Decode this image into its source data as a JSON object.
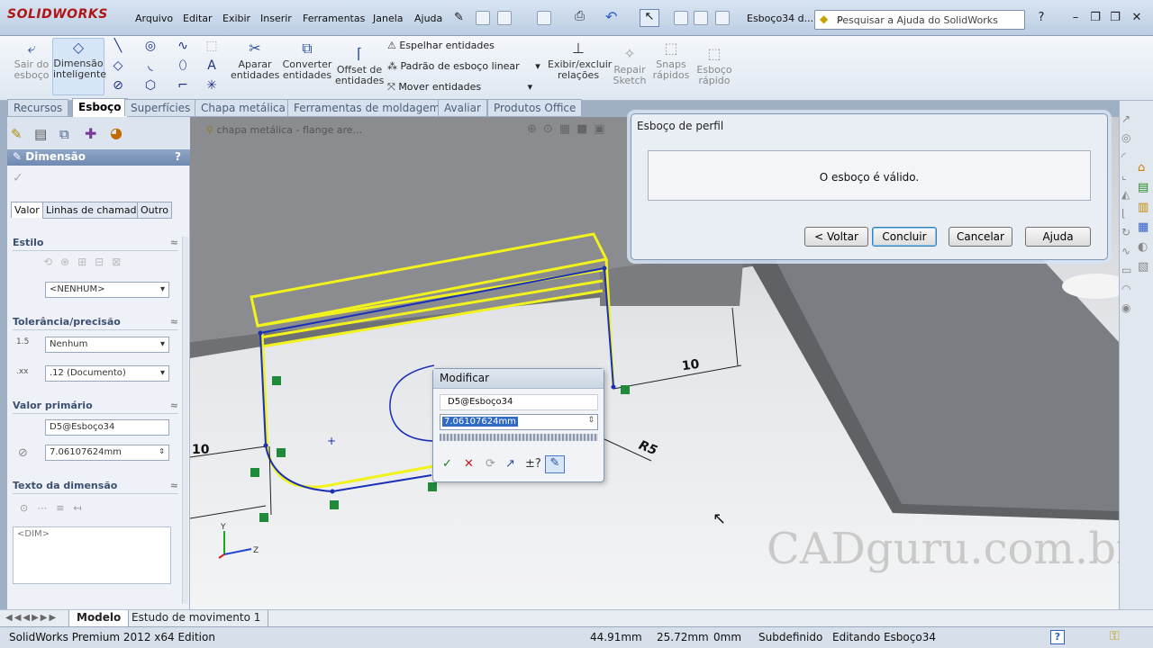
{
  "app": {
    "logo_text": "SOLIDWORKS",
    "menu": [
      "Arquivo",
      "Editar",
      "Exibir",
      "Inserir",
      "Ferramentas",
      "Janela",
      "Ajuda"
    ],
    "document_title": "Esboço34 d...",
    "search_placeholder": "Pesquisar a Ajuda do SolidWorks"
  },
  "commandmanager": {
    "exit_sketch": "Sair do esboço",
    "smart_dim_1": "Dimensão",
    "smart_dim_2": "inteligente",
    "trim_1": "Aparar",
    "trim_2": "entidades",
    "convert_1": "Converter",
    "convert_2": "entidades",
    "offset_1": "Offset de",
    "offset_2": "entidades",
    "mirror": "Espelhar entidades",
    "linear_pattern": "Padrão de esboço linear",
    "move": "Mover entidades",
    "relations_1": "Exibir/excluir",
    "relations_2": "relações",
    "repair_1": "Repair",
    "repair_2": "Sketch",
    "snaps_1": "Snaps",
    "snaps_2": "rápidos",
    "rapid_1": "Esboço",
    "rapid_2": "rápido"
  },
  "tabs": [
    "Recursos",
    "Esboço",
    "Superfícies",
    "Chapa metálica",
    "Ferramentas de moldagem",
    "Avaliar",
    "Produtos Office"
  ],
  "breadcrumb": "chapa metálica - flange are...",
  "property_manager": {
    "title": "Dimensão",
    "help": "?",
    "tabs": [
      "Valor",
      "Linhas de chamada",
      "Outro"
    ],
    "style_label": "Estilo",
    "style_value": "<NENHUM>",
    "tolerance_label": "Tolerância/precisão",
    "tolerance_value": "Nenhum",
    "precision_value": ".12 (Documento)",
    "primary_label": "Valor primário",
    "primary_name": "D5@Esboço34",
    "primary_value": "7.06107624mm",
    "text_label": "Texto da dimensão",
    "text_value": "<DIM>"
  },
  "profile_dialog": {
    "title": "Esboço de perfil",
    "message": "O esboço é válido.",
    "back": "< Voltar",
    "finish": "Concluir",
    "cancel": "Cancelar",
    "help": "Ajuda"
  },
  "modify_dialog": {
    "title": "Modificar",
    "name": "D5@Esboço34",
    "value": "7.06107624mm"
  },
  "dimensions": {
    "top_dim": "10",
    "left_dim": "10",
    "radius": "R5"
  },
  "watermark": "CADguru.com.br",
  "bottom_tabs": [
    "Modelo",
    "Estudo de movimento 1"
  ],
  "status": {
    "edition": "SolidWorks Premium 2012 x64 Edition",
    "x": "44.91mm",
    "y": "25.72mm",
    "z": "0mm",
    "state": "Subdefinido",
    "editing": "Editando Esboço34",
    "help": "?"
  },
  "colors": {
    "sketch_blue": "#1a2fb8",
    "preview_yellow": "#f2f21c",
    "relation_green": "#1e8a3a",
    "brand_red": "#b01515"
  }
}
